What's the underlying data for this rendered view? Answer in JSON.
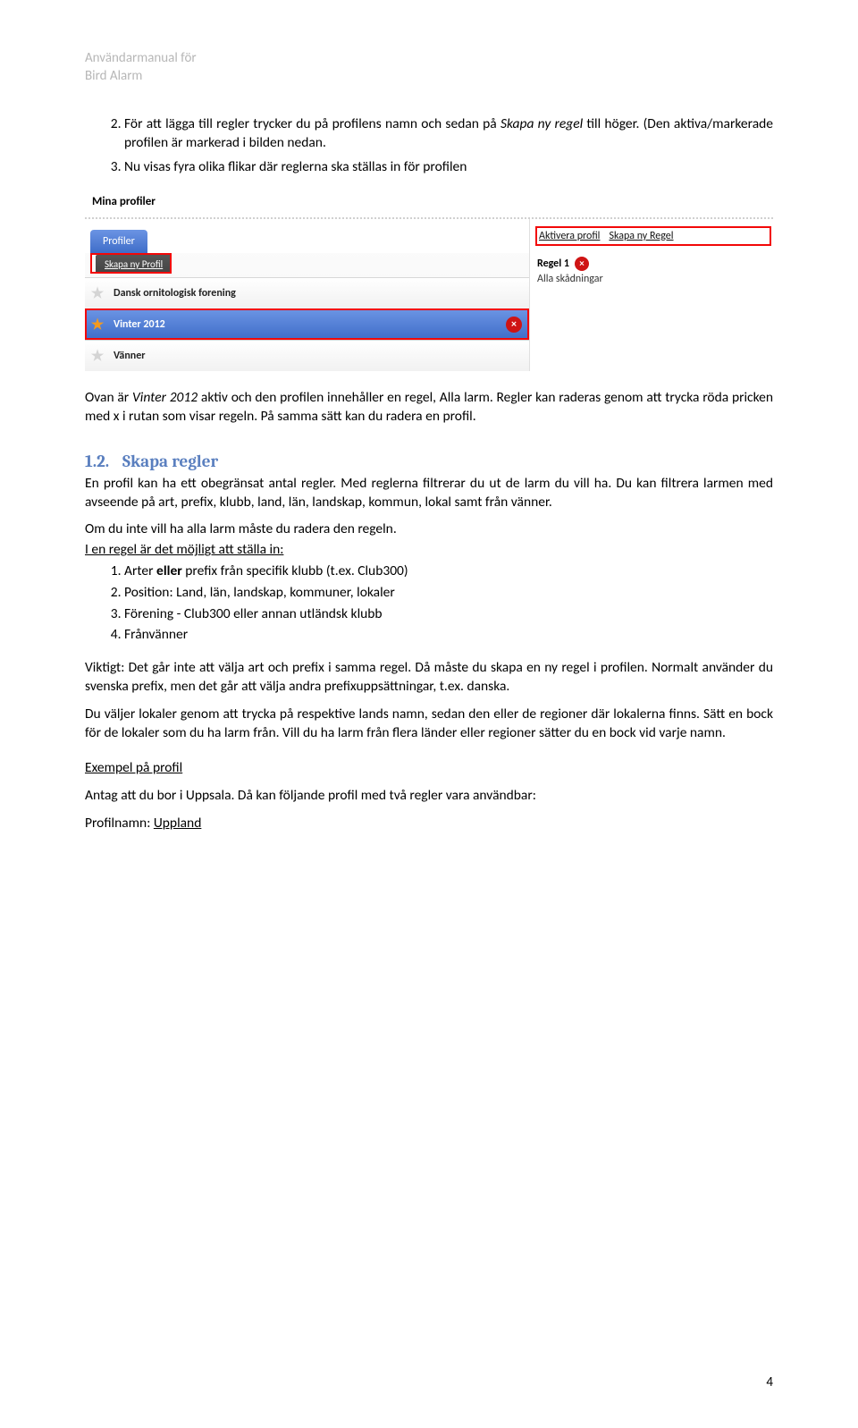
{
  "header": {
    "line1": "Användarmanual för",
    "line2": "Bird Alarm"
  },
  "step2_prefix": "För att lägga till regler trycker du på profilens namn och sedan på ",
  "step2_italic": "Skapa ny regel",
  "step2_suffix": " till höger. (Den aktiva/markerade profilen är markerad i bilden nedan.",
  "step3": "Nu visas fyra olika flikar där reglerna ska ställas in för profilen",
  "screenshot": {
    "title": "Mina profiler",
    "tab": "Profiler",
    "skapa_btn": "Skapa ny Profil",
    "rows": [
      {
        "label": "Dansk ornitologisk forening"
      },
      {
        "label": "Vinter 2012"
      },
      {
        "label": "Vänner"
      }
    ],
    "right_links": {
      "aktivera": "Aktivera profil",
      "skapa_regel": "Skapa ny Regel"
    },
    "regel_name": "Regel 1",
    "regel_sub": "Alla skådningar"
  },
  "after_ss_a": "Ovan är ",
  "after_ss_italic": "Vinter 2012",
  "after_ss_b": " aktiv och den profilen innehåller en regel, Alla larm. Regler kan raderas genom att trycka röda pricken med x i rutan som visar regeln. På samma sätt kan du radera en profil.",
  "sec_num": "1.2.",
  "sec_title": "Skapa regler",
  "body1": "En profil kan ha ett obegränsat antal regler. Med reglerna filtrerar du ut de larm du vill ha. Du kan filtrera larmen med avseende på art, prefix, klubb, land, län, landskap, kommun, lokal samt från vänner.",
  "body2": "Om du inte vill ha alla larm måste du radera den regeln.",
  "body3": "I en regel är det möjligt att ställa in:",
  "inner_items": {
    "1_a": "Arter ",
    "1_bold": "eller",
    "1_b": " prefix från specifik klubb (t.ex. Club300)",
    "2": "Position: Land, län, landskap, kommuner, lokaler",
    "3": "Förening - Club300 eller annan utländsk klubb",
    "4": "Frånvänner"
  },
  "body4": "Viktigt: Det går inte att välja art och prefix i samma regel. Då måste du skapa en ny regel i profilen. Normalt använder du svenska prefix, men det går att välja andra prefixuppsättningar, t.ex. danska.",
  "body5": "Du väljer lokaler genom att trycka på respektive lands namn, sedan den eller de regioner där lokalerna finns. Sätt en bock för de lokaler som du ha larm från. Vill du ha larm från flera länder eller regioner sätter du en bock vid varje namn.",
  "example_heading": "Exempel på profil",
  "body6": "Antag att du bor i Uppsala. Då kan följande profil med två regler vara användbar:",
  "profilnamn_label": "Profilnamn: ",
  "profilnamn_value": "Uppland",
  "page_number": "4"
}
